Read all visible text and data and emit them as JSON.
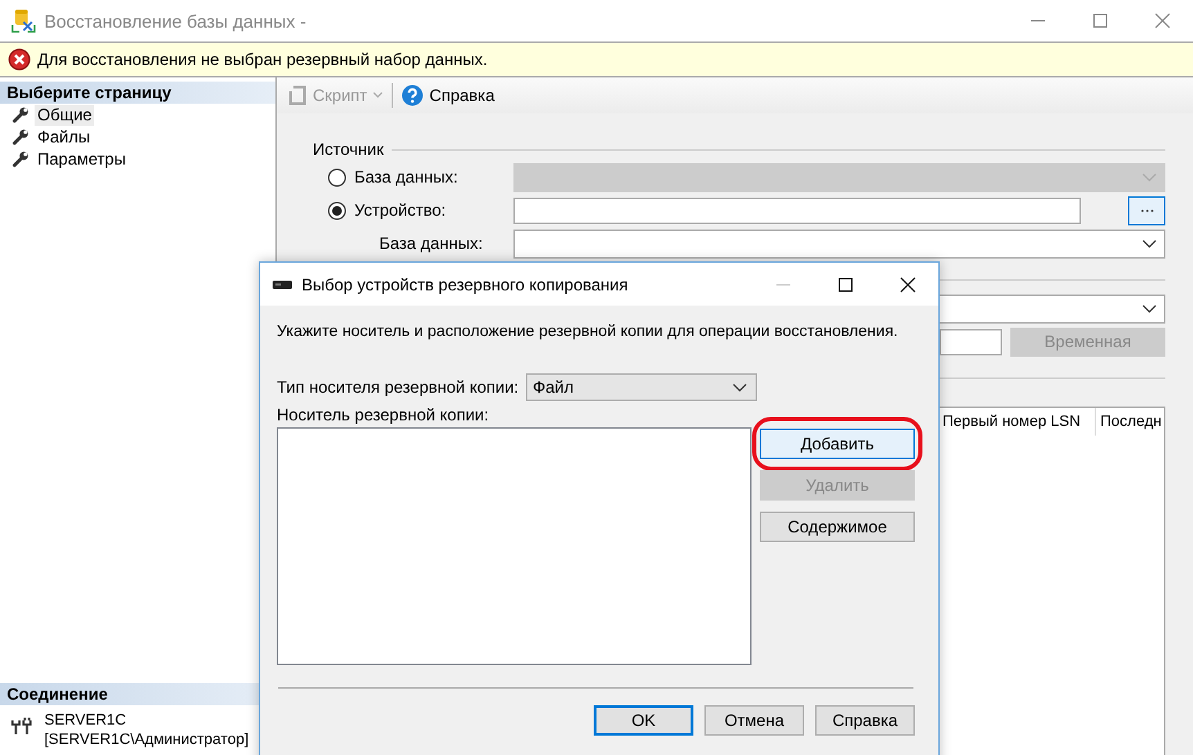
{
  "window": {
    "title": "Восстановление базы данных -"
  },
  "banner": {
    "kind": "error",
    "text": "Для восстановления не выбран резервный набор данных."
  },
  "sidebar": {
    "header": "Выберите страницу",
    "items": [
      {
        "label": "Общие",
        "selected": true
      },
      {
        "label": "Файлы",
        "selected": false
      },
      {
        "label": "Параметры",
        "selected": false
      }
    ],
    "connection": {
      "header": "Соединение",
      "server": "SERVER1C",
      "user": "[SERVER1C\\Администратор]"
    }
  },
  "toolbar": {
    "items": [
      {
        "kind": "script",
        "label": "Скрипт",
        "disabled": true
      },
      {
        "kind": "help",
        "label": "Справка",
        "disabled": false
      }
    ]
  },
  "source": {
    "title": "Источник",
    "options": [
      {
        "kind": "select",
        "label": "База данных:",
        "selected": false
      },
      {
        "kind": "device",
        "label": "Устройство:",
        "selected": true
      }
    ],
    "database_label": "База данных:"
  },
  "section_2": {
    "button": {
      "label": "Временная",
      "disabled": true
    }
  },
  "backup_sets_table": {
    "columns": [
      "Первый номер LSN",
      "Последн"
    ]
  },
  "dialog": {
    "title": "Выбор устройств резервного копирования",
    "description": "Укажите носитель и расположение резервной копии для операции восстановления.",
    "media_type": {
      "label": "Тип носителя резервной копии:",
      "value": "Файл"
    },
    "media_list": {
      "label": "Носитель резервной копии:"
    },
    "side_buttons": [
      {
        "label": "Добавить",
        "disabled": false,
        "highlighted": true
      },
      {
        "label": "Удалить",
        "disabled": true,
        "highlighted": false
      },
      {
        "label": "Содержимое",
        "disabled": false,
        "highlighted": false
      }
    ],
    "buttons": [
      {
        "label": "OK",
        "default": true
      },
      {
        "label": "Отмена",
        "default": false
      },
      {
        "label": "Справка",
        "default": false
      }
    ]
  }
}
